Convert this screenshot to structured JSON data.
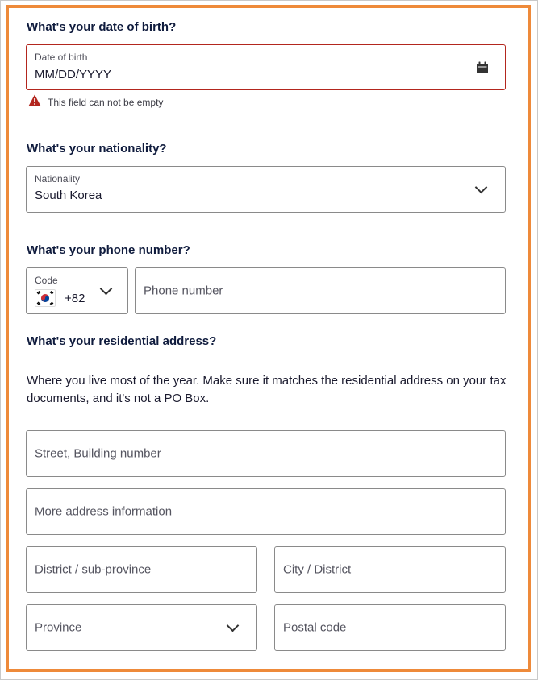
{
  "dob": {
    "question": "What's your date of birth?",
    "label": "Date of birth",
    "value": "MM/DD/YYYY",
    "error": "This field can not be empty"
  },
  "nationality": {
    "question": "What's your nationality?",
    "label": "Nationality",
    "value": "South Korea"
  },
  "phone": {
    "question": "What's your phone number?",
    "code_label": "Code",
    "code_value": "+82",
    "placeholder": "Phone number"
  },
  "address": {
    "question": "What's your residential address?",
    "description": "Where you live most of the year. Make sure it matches the residential address on your tax documents, and it's not a PO Box.",
    "street_placeholder": "Street, Building number",
    "more_placeholder": "More address information",
    "district_placeholder": "District / sub-province",
    "city_placeholder": "City / District",
    "province_placeholder": "Province",
    "postal_placeholder": "Postal code"
  },
  "colors": {
    "frame_accent": "#ee8a3a",
    "error": "#b3261e",
    "heading": "#0f1b3d"
  }
}
